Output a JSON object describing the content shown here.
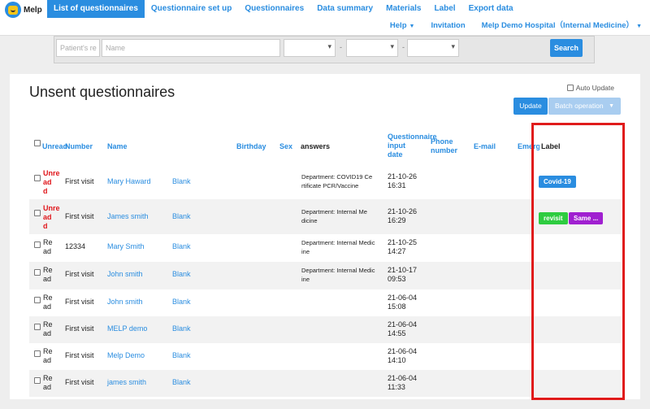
{
  "app": {
    "name": "Melp"
  },
  "nav": {
    "main": [
      "List of questionnaires",
      "Questionnaire set up",
      "Questionnaires",
      "Data summary",
      "Materials",
      "Label",
      "Export data"
    ],
    "sub": {
      "help": "Help",
      "invitation": "Invitation",
      "hospital": "Melp Demo Hospital（Internal Medicine）"
    }
  },
  "search": {
    "patient_placeholder": "Patient's re",
    "name_placeholder": "Name",
    "dash": "-",
    "button": "Search"
  },
  "panel": {
    "title": "Unsent questionnaires",
    "auto_update": "Auto Update",
    "update_button": "Update",
    "batch_button": "Batch operation"
  },
  "table": {
    "headers": {
      "unread": "Unread",
      "number": "Number",
      "name": "Name",
      "birthday": "Birthday",
      "sex": "Sex",
      "answers": "answers",
      "input_date": [
        "Questionnaire",
        "input",
        "date"
      ],
      "phone": [
        "Phone",
        "number"
      ],
      "email": "E-mail",
      "emergency": "Emergency",
      "label": "Label"
    },
    "rows": [
      {
        "status": [
          "Unre",
          "ad"
        ],
        "unread": true,
        "number": "First visit",
        "name": "Mary Haward",
        "blank": "Blank",
        "answers": [
          "Department: COVID19 Ce",
          "rtificate PCR/Vaccine"
        ],
        "date": [
          "21-10-26",
          "16:31"
        ],
        "labels": [
          {
            "text": "Covid-19",
            "color": "#2a8de0"
          }
        ]
      },
      {
        "status": [
          "Unre",
          "ad"
        ],
        "unread": true,
        "number": "First visit",
        "name": "James smith",
        "blank": "Blank",
        "answers": [
          "Department: Internal Me",
          "dicine"
        ],
        "date": [
          "21-10-26",
          "16:29"
        ],
        "labels": [
          {
            "text": "revisit",
            "color": "#2ecc40"
          },
          {
            "text": "Same ...",
            "color": "#a020d0"
          }
        ]
      },
      {
        "status": [
          "Re",
          "ad"
        ],
        "unread": false,
        "number": "12334",
        "name": "Mary Smith",
        "blank": "Blank",
        "answers": [
          "Department: Internal Medic",
          "ine"
        ],
        "date": [
          "21-10-25",
          "14:27"
        ],
        "labels": []
      },
      {
        "status": [
          "Re",
          "ad"
        ],
        "unread": false,
        "number": "First visit",
        "name": "John smith",
        "blank": "Blank",
        "answers": [
          "Department: Internal Medic",
          "ine"
        ],
        "date": [
          "21-10-17",
          "09:53"
        ],
        "labels": []
      },
      {
        "status": [
          "Re",
          "ad"
        ],
        "unread": false,
        "number": "First visit",
        "name": "John smith",
        "blank": "Blank",
        "answers": [],
        "date": [
          "21-06-04",
          "15:08"
        ],
        "labels": []
      },
      {
        "status": [
          "Re",
          "ad"
        ],
        "unread": false,
        "number": "First visit",
        "name": "MELP demo",
        "blank": "Blank",
        "answers": [],
        "date": [
          "21-06-04",
          "14:55"
        ],
        "labels": []
      },
      {
        "status": [
          "Re",
          "ad"
        ],
        "unread": false,
        "number": "First visit",
        "name": "Melp Demo",
        "blank": "Blank",
        "answers": [],
        "date": [
          "21-06-04",
          "14:10"
        ],
        "labels": []
      },
      {
        "status": [
          "Re",
          "ad"
        ],
        "unread": false,
        "number": "First visit",
        "name": "james smith",
        "blank": "Blank",
        "answers": [],
        "date": [
          "21-06-04",
          "11:33"
        ],
        "labels": []
      }
    ]
  },
  "colors": {
    "accent": "#2a8de0",
    "unread": "#e0161b",
    "highlight_box": "#e01b1b"
  }
}
